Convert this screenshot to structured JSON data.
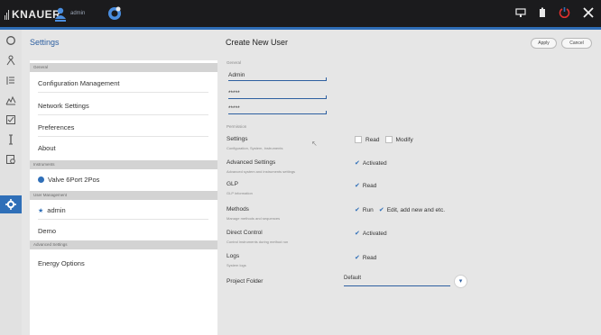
{
  "app": {
    "brand": "KNAUER",
    "user_name": "admin"
  },
  "icons": {
    "rail": [
      "search-icon",
      "pump-icon",
      "sequence-icon",
      "chart-icon",
      "checklist-icon",
      "column-icon",
      "report-icon",
      "gear-icon"
    ],
    "top_right": [
      "display-icon",
      "battery-icon",
      "power-icon",
      "close-icon"
    ]
  },
  "sidebar": {
    "title": "Settings",
    "groups": [
      {
        "label": "General",
        "items": [
          "Configuration Management",
          "Network Settings",
          "Preferences",
          "About"
        ]
      },
      {
        "label": "Instruments",
        "items": [
          "Valve 6Port 2Pos"
        ]
      },
      {
        "label": "User Management",
        "items": [
          "admin",
          "Demo"
        ]
      },
      {
        "label": "Advanced Settings",
        "items": [
          "Energy Options"
        ]
      }
    ]
  },
  "main": {
    "title": "Create New User",
    "apply_label": "Apply",
    "cancel_label": "Cancel",
    "general_label": "General",
    "username_value": "Admin",
    "password_value": "*****",
    "password_confirm_value": "*****",
    "permission_label": "Permission",
    "permissions": {
      "settings": {
        "label": "Settings",
        "sub": "Configuration, System, Instruments",
        "opt1": "Read",
        "opt2": "Modify"
      },
      "advanced": {
        "label": "Advanced Settings",
        "sub": "Advanced system and instruments settings",
        "opt1": "Activated"
      },
      "glp": {
        "label": "GLP",
        "sub": "GLP information",
        "opt1": "Read"
      },
      "methods": {
        "label": "Methods",
        "sub": "Manage methods and sequences",
        "opt1": "Run",
        "opt2": "Edit, add new and etc."
      },
      "direct": {
        "label": "Direct Control",
        "sub": "Control instruments during method run",
        "opt1": "Activated"
      },
      "logs": {
        "label": "Logs",
        "sub": "System logs",
        "opt1": "Read"
      }
    },
    "project_folder_label": "Project Folder",
    "project_folder_value": "Default"
  },
  "colors": {
    "accent": "#2f6fb8",
    "topbar": "#1b1b1d",
    "background": "#e6e6e6"
  }
}
